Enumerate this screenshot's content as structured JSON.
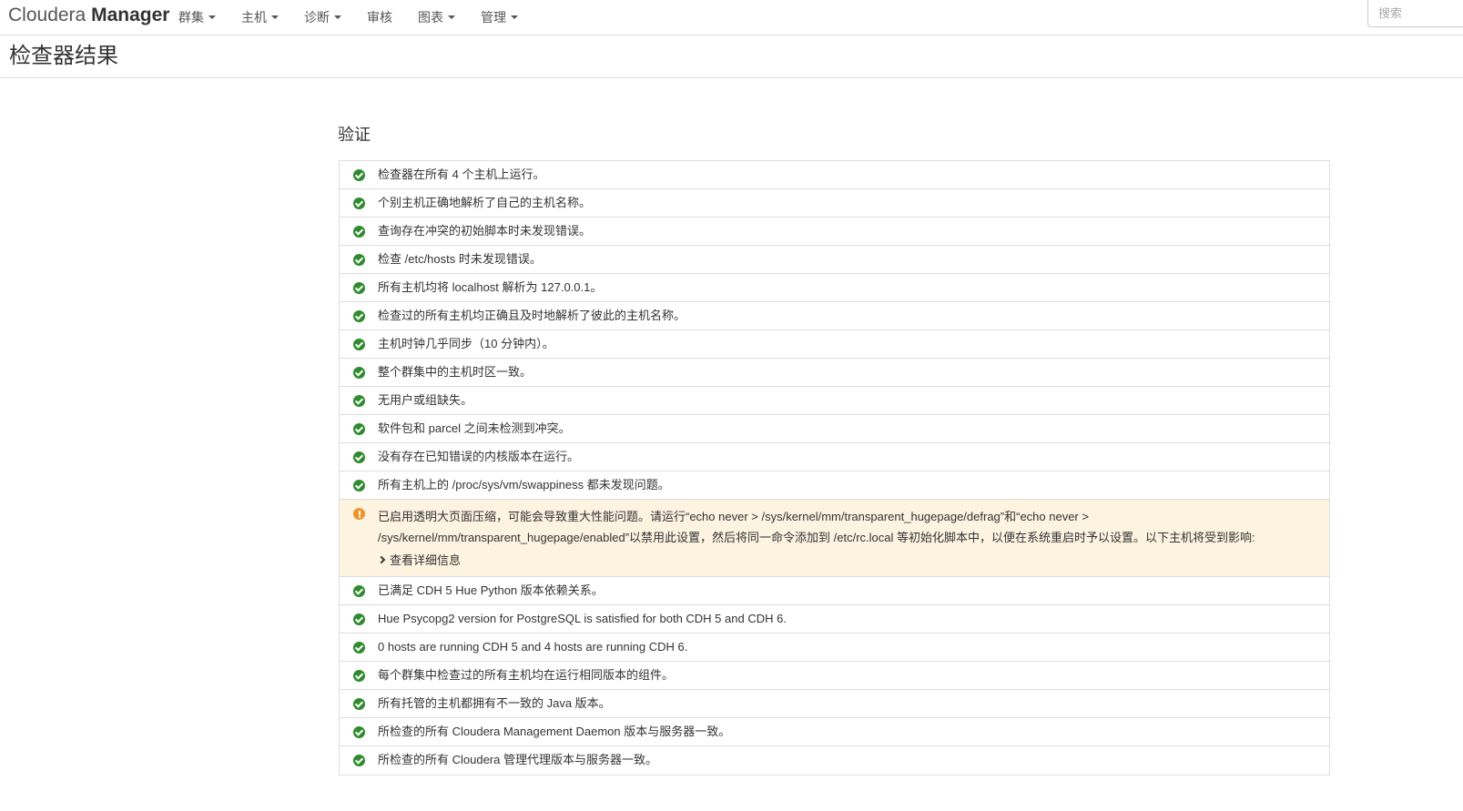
{
  "navbar": {
    "brand_light": "Cloudera",
    "brand_bold": "Manager",
    "items": [
      {
        "label": "群集",
        "dropdown": true
      },
      {
        "label": "主机",
        "dropdown": true
      },
      {
        "label": "诊断",
        "dropdown": true
      },
      {
        "label": "审核",
        "dropdown": false
      },
      {
        "label": "图表",
        "dropdown": true
      },
      {
        "label": "管理",
        "dropdown": true
      }
    ],
    "search_placeholder": "搜索"
  },
  "page": {
    "title": "检查器结果"
  },
  "validation": {
    "title": "验证",
    "items": [
      {
        "status": "ok",
        "text": "检查器在所有 4 个主机上运行。"
      },
      {
        "status": "ok",
        "text": "个别主机正确地解析了自己的主机名称。"
      },
      {
        "status": "ok",
        "text": "查询存在冲突的初始脚本时未发现错误。"
      },
      {
        "status": "ok",
        "text": "检查 /etc/hosts 时未发现错误。"
      },
      {
        "status": "ok",
        "text": "所有主机均将 localhost 解析为 127.0.0.1。"
      },
      {
        "status": "ok",
        "text": "检查过的所有主机均正确且及时地解析了彼此的主机名称。"
      },
      {
        "status": "ok",
        "text": "主机时钟几乎同步（10 分钟内）。"
      },
      {
        "status": "ok",
        "text": "整个群集中的主机时区一致。"
      },
      {
        "status": "ok",
        "text": "无用户或组缺失。"
      },
      {
        "status": "ok",
        "text": "软件包和 parcel 之间未检测到冲突。"
      },
      {
        "status": "ok",
        "text": "没有存在已知错误的内核版本在运行。"
      },
      {
        "status": "ok",
        "text": "所有主机上的 /proc/sys/vm/swappiness 都未发现问题。"
      },
      {
        "status": "warning",
        "text": "已启用透明大页面压缩，可能会导致重大性能问题。请运行“echo never > /sys/kernel/mm/transparent_hugepage/defrag”和“echo never > /sys/kernel/mm/transparent_hugepage/enabled”以禁用此设置，然后将同一命令添加到 /etc/rc.local 等初始化脚本中，以便在系统重启时予以设置。以下主机将受到影响:",
        "details_label": "查看详细信息"
      },
      {
        "status": "ok",
        "text": "已满足 CDH 5 Hue Python 版本依赖关系。"
      },
      {
        "status": "ok",
        "text": "Hue Psycopg2 version for PostgreSQL is satisfied for both CDH 5 and CDH 6."
      },
      {
        "status": "ok",
        "text": "0 hosts are running CDH 5 and 4 hosts are running CDH 6."
      },
      {
        "status": "ok",
        "text": "每个群集中检查过的所有主机均在运行相同版本的组件。"
      },
      {
        "status": "ok",
        "text": "所有托管的主机都拥有不一致的 Java 版本。"
      },
      {
        "status": "ok",
        "text": "所检查的所有 Cloudera Management Daemon 版本与服务器一致。"
      },
      {
        "status": "ok",
        "text": "所检查的所有 Cloudera 管理代理版本与服务器一致。"
      }
    ]
  },
  "colors": {
    "ok": "#2e8b2e",
    "warning": "#f0932b",
    "warning_bg": "#fdf3e1"
  }
}
